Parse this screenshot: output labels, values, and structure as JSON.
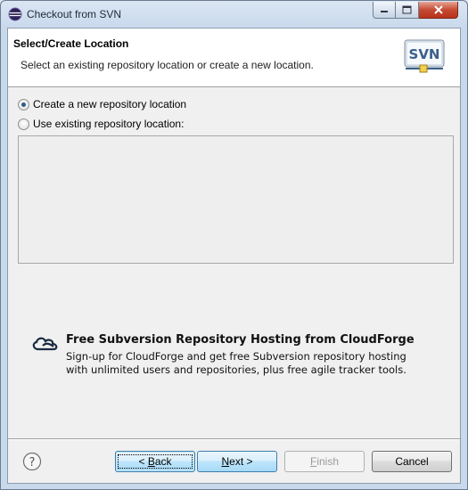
{
  "window": {
    "title": "Checkout from SVN"
  },
  "header": {
    "title": "Select/Create Location",
    "description": "Select an existing repository location or create a new location.",
    "logo_text": "SVN"
  },
  "options": [
    {
      "label": "Create a new repository location",
      "checked": true
    },
    {
      "label": "Use existing repository location:",
      "checked": false
    }
  ],
  "promo": {
    "title": "Free Subversion Repository Hosting from CloudForge",
    "line1": "Sign-up for CloudForge and get free Subversion repository hosting",
    "line2": "with unlimited users and repositories, plus free agile tracker tools."
  },
  "buttons": {
    "back_prefix": "< ",
    "back_accel": "B",
    "back_rest": "ack",
    "next_accel": "N",
    "next_rest": "ext >",
    "finish_accel": "F",
    "finish_rest": "inish",
    "cancel": "Cancel"
  },
  "icons": {
    "app": "eclipse-icon",
    "logo": "svn-logo-icon",
    "cloud": "cloudforge-icon",
    "help": "help-icon"
  }
}
